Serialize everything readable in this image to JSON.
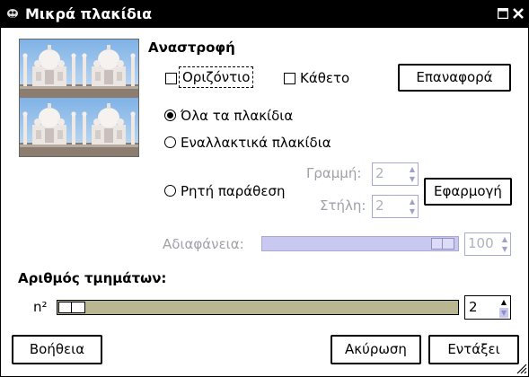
{
  "window": {
    "title": "Μικρά πλακίδια"
  },
  "flip": {
    "heading": "Αναστροφή",
    "horizontal_label": "Οριζόντιο",
    "vertical_label": "Κάθετο",
    "horizontal_checked": false,
    "vertical_checked": false,
    "reset_label": "Επαναφορά"
  },
  "tiles": {
    "all_label": "Όλα τα πλακίδια",
    "alternate_label": "Εναλλακτικά πλακίδια",
    "explicit_label": "Ρητή παράθεση",
    "selected": "all",
    "row_label": "Γραμμή:",
    "row_value": "2",
    "column_label": "Στήλη:",
    "column_value": "2",
    "apply_label": "Εφαρμογή"
  },
  "opacity": {
    "label": "Αδιαφάνεια:",
    "value": "100",
    "level_fraction": 1.0
  },
  "segments": {
    "label": "Αριθμός τμημάτων:",
    "prefix": "n²",
    "value": "2",
    "level_fraction": 0.0
  },
  "buttons": {
    "help": "Βοήθεια",
    "cancel": "Ακύρωση",
    "ok": "Εντάξει"
  },
  "colors": {
    "slider_fill_disabled": "#c8c8f0",
    "slider_fill_active": "#b9b692",
    "titlebar": "#000000"
  }
}
